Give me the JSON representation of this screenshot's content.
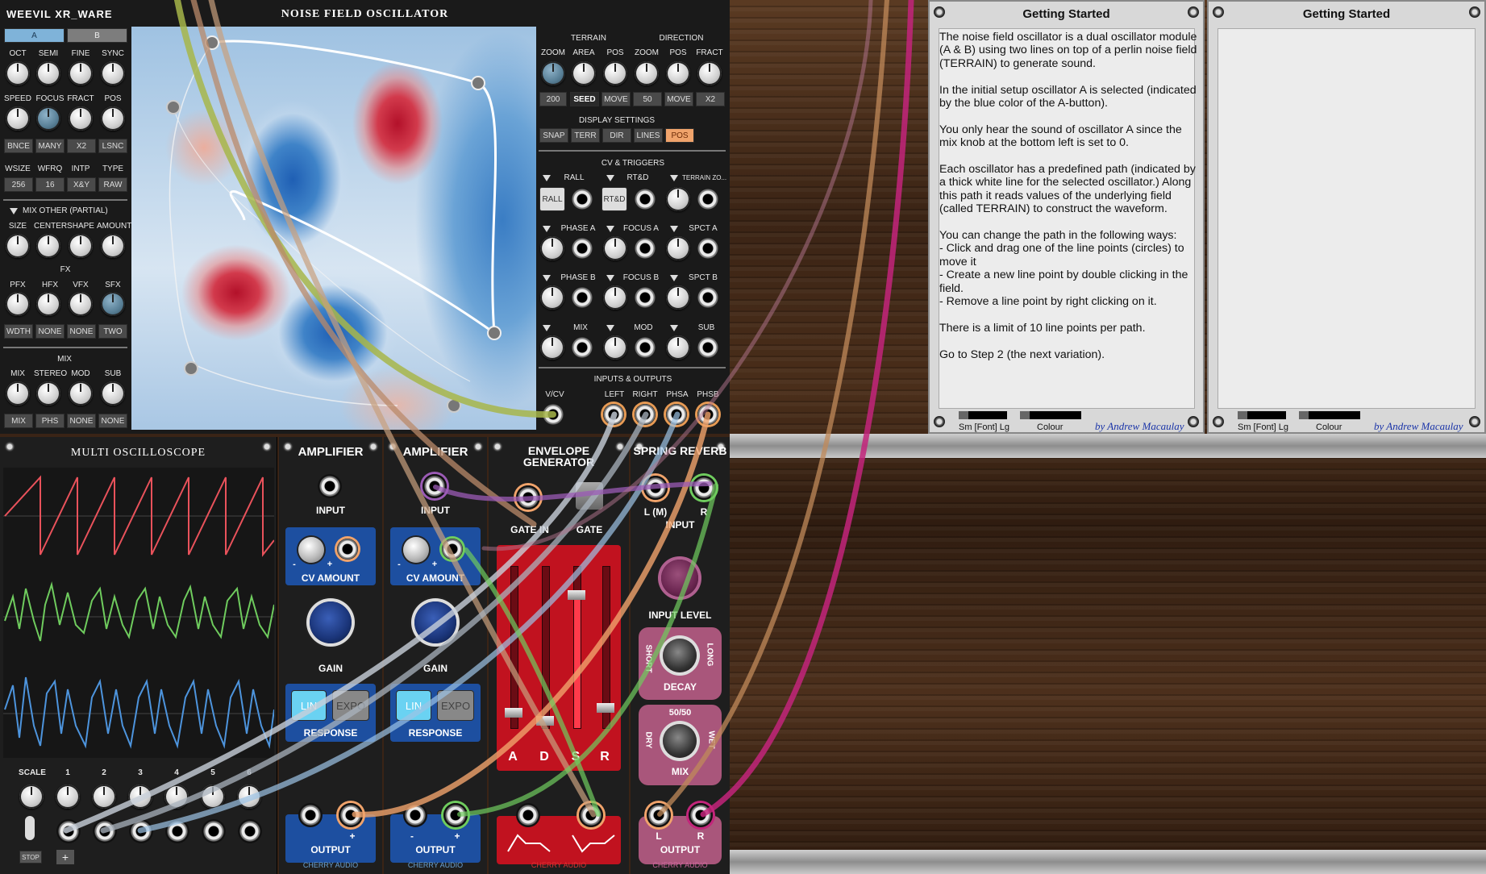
{
  "noise_osc": {
    "brand": "WEEVIL XR_WARE",
    "title": "NOISE FIELD OSCILLATOR",
    "osc_buttons": [
      "A",
      "B"
    ],
    "row1_labels": [
      "OCT",
      "SEMI",
      "FINE",
      "SYNC"
    ],
    "row2_labels": [
      "SPEED",
      "FOCUS",
      "FRACT",
      "POS"
    ],
    "row2_buttons": [
      "BNCE",
      "MANY",
      "X2",
      "LSNC"
    ],
    "row3_labels": [
      "WSIZE",
      "WFRQ",
      "INTP",
      "TYPE"
    ],
    "row3_buttons": [
      "256",
      "16",
      "X&Y",
      "RAW"
    ],
    "mix_other": "MIX OTHER (PARTIAL)",
    "row4_labels": [
      "SIZE",
      "CENTER",
      "SHAPE",
      "AMOUNT"
    ],
    "fx_title": "FX",
    "row5_labels": [
      "PFX",
      "HFX",
      "VFX",
      "SFX"
    ],
    "row5_buttons": [
      "WDTH",
      "NONE",
      "NONE",
      "TWO"
    ],
    "mix_title": "MIX",
    "row6_labels": [
      "MIX",
      "STEREO",
      "MOD",
      "SUB"
    ],
    "row6_buttons": [
      "MIX",
      "PHS",
      "NONE",
      "NONE"
    ],
    "terrain": "TERRAIN",
    "direction": "DIRECTION",
    "right_labels": [
      "ZOOM",
      "AREA",
      "POS",
      "ZOOM",
      "POS",
      "FRACT"
    ],
    "right_buttons": [
      "200",
      "SEED",
      "MOVE",
      "50",
      "MOVE",
      "X2"
    ],
    "display_settings": "DISPLAY SETTINGS",
    "display_buttons": [
      "SNAP",
      "TERR",
      "DIR",
      "LINES",
      "POS"
    ],
    "cv_triggers": "CV & TRIGGERS",
    "cv_row1": [
      "RALL",
      "RT&D",
      "TERRAIN ZO..."
    ],
    "cv_row1_buttons": [
      "RALL",
      "RT&D"
    ],
    "cv_row2": [
      "PHASE A",
      "FOCUS A",
      "SPCT A"
    ],
    "cv_row3": [
      "PHASE B",
      "FOCUS B",
      "SPCT B"
    ],
    "cv_row4": [
      "MIX",
      "MOD",
      "SUB"
    ],
    "io_title": "INPUTS & OUTPUTS",
    "io_labels": [
      "V/CV",
      "LEFT",
      "RIGHT",
      "PHSA",
      "PHSB"
    ]
  },
  "getting_started": {
    "title": "Getting Started",
    "paragraphs": [
      "The noise field oscillator is a dual oscillator module (A & B) using two lines on top of a perlin noise field (TERRAIN) to generate sound.",
      "In the initial setup oscillator A is selected (indicated by the blue color of the A-button).",
      "You only hear the sound of oscillator A since the mix knob at the bottom left is set to 0.",
      "Each oscillator has a predefined path (indicated by a thick white line for the selected oscillator.) Along this path it reads values of the underlying field (called TERRAIN) to construct the waveform.",
      "You can change the path in the following ways:\n- Click and drag one of the line points (circles) to move it\n- Create a new line point by double clicking in the field.\n- Remove a line point by right clicking on it.",
      "There is a limit of 10 line points per path.",
      "Go to Step 2 (the next variation)."
    ],
    "font_label": "Sm [Font] Lg",
    "colour_label": "Colour",
    "author": "by Andrew Macaulay"
  },
  "scope": {
    "title": "MULTI OSCILLOSCOPE",
    "scale": "SCALE",
    "channels": [
      "1",
      "2",
      "3",
      "4",
      "5",
      "6"
    ],
    "stop": "STOP",
    "trace_colors": [
      "#e9525b",
      "#6fcc5e",
      "#4d94dd"
    ]
  },
  "amp1": {
    "title": "AMPLIFIER",
    "input": "INPUT",
    "cv": "CV AMOUNT",
    "gain": "GAIN",
    "lin": "LIN",
    "expo": "EXPO",
    "response": "RESPONSE",
    "output": "OUTPUT",
    "minus": "-",
    "plus": "+",
    "brand": "CHERRY AUDIO"
  },
  "amp2": {
    "title": "AMPLIFIER",
    "input": "INPUT",
    "cv": "CV AMOUNT",
    "gain": "GAIN",
    "lin": "LIN",
    "expo": "EXPO",
    "response": "RESPONSE",
    "output": "OUTPUT",
    "minus": "-",
    "plus": "+",
    "brand": "CHERRY AUDIO"
  },
  "env": {
    "title": "ENVELOPE GENERATOR",
    "gate_in": "GATE IN",
    "gate": "GATE",
    "stages": [
      "A",
      "D",
      "S",
      "R"
    ],
    "brand": "CHERRY AUDIO"
  },
  "reverb": {
    "title": "SPRING REVERB",
    "l": "L (M)",
    "r": "R",
    "input": "INPUT",
    "input_level": "INPUT LEVEL",
    "short": "SHORT",
    "long": "LONG",
    "decay": "DECAY",
    "fifty": "50/50",
    "dry": "DRY",
    "wet": "WET",
    "mix": "MIX",
    "out_l": "L",
    "out_r": "R",
    "output": "OUTPUT",
    "brand": "CHERRY AUDIO"
  },
  "colors": {
    "panel": "#1a1a1a",
    "amp_blue": "#1d4fa0",
    "env_red": "#c1121f",
    "reverb_pink": "#a9567b",
    "accent_orange": "#f0a36b",
    "button_blue": "#7fb3d9"
  }
}
